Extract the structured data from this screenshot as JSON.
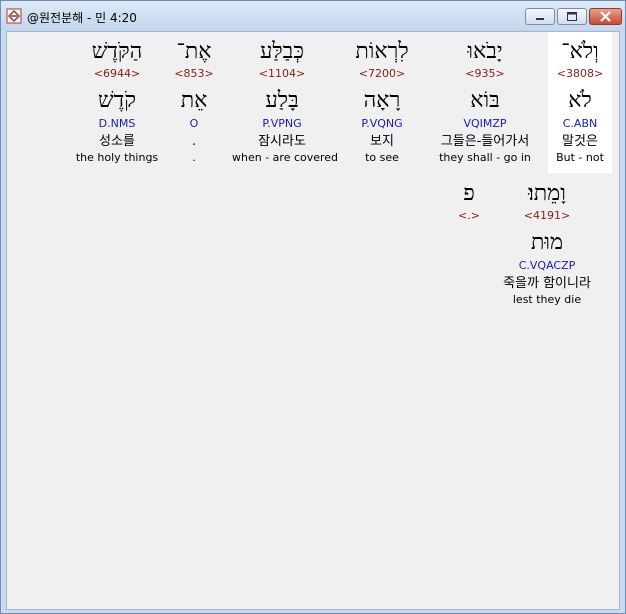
{
  "window": {
    "title": "@원전분해 - 민 4:20",
    "icon": "bible-app-icon",
    "controls": [
      "minimize-icon",
      "maximize-icon",
      "close-icon"
    ]
  },
  "colors": {
    "strong_number": "#8b1a1a",
    "morphology": "#1a1ab0",
    "text": "#000000",
    "selected_bg": "#ffffff"
  },
  "words": [
    {
      "hebrew": "וְלֹא־",
      "strong": "<3808>",
      "lemma": "לֹא",
      "morph": "C.ABN",
      "korean": "말것은",
      "english": "But - not"
    },
    {
      "hebrew": "יָבֹאוּ",
      "strong": "<935>",
      "lemma": "בּוֹא",
      "morph": "VQIMZP",
      "korean": "그들은-들어가서",
      "english": "they shall - go in"
    },
    {
      "hebrew": "לִרְאוֹת",
      "strong": "<7200>",
      "lemma": "רָאָה",
      "morph": "P.VQNG",
      "korean": "보지",
      "english": "to see"
    },
    {
      "hebrew": "כְּבַלַּע",
      "strong": "<1104>",
      "lemma": "בָּלַע",
      "morph": "P.VPNG",
      "korean": "잠시라도",
      "english": "when - are covered"
    },
    {
      "hebrew": "אֶת־",
      "strong": "<853>",
      "lemma": "אֵת",
      "morph": "O",
      "korean": ".",
      "english": "."
    },
    {
      "hebrew": "הַקֹּדֶשׁ",
      "strong": "<6944>",
      "lemma": "קֹדֶשׁ",
      "morph": "D.NMS",
      "korean": "성소를",
      "english": "the holy things"
    },
    {
      "hebrew": "וָמֵתוּ׃",
      "strong": "<4191>",
      "lemma": "מוּת",
      "morph": "C.VQACZP",
      "korean": "죽을까 함이니라",
      "english": "lest they die"
    },
    {
      "hebrew": "פ",
      "strong": "<.>",
      "lemma": "",
      "morph": "",
      "korean": "",
      "english": ""
    }
  ]
}
